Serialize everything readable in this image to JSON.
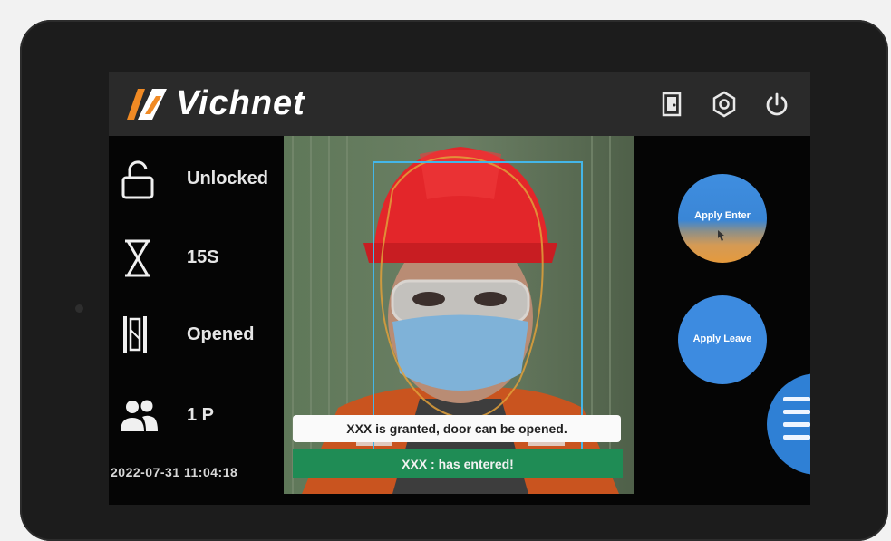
{
  "brand": {
    "name": "Vichnet"
  },
  "header": {
    "icons": [
      "door-icon",
      "settings-icon",
      "power-icon"
    ]
  },
  "status": {
    "lock": "Unlocked",
    "timer": "15S",
    "door": "Opened",
    "people": "1 P"
  },
  "datetime": "2022-07-31 11:04:18",
  "messages": {
    "granted": "XXX  is granted, door can be opened.",
    "entered": "XXX : has entered!"
  },
  "buttons": {
    "apply_enter": "Apply Enter",
    "apply_leave": "Apply Leave"
  },
  "colors": {
    "face_box": "#44b6e8",
    "entered_bar": "#1f8c55",
    "button_blue": "#3d8be0",
    "logo_orange": "#f08a24"
  }
}
